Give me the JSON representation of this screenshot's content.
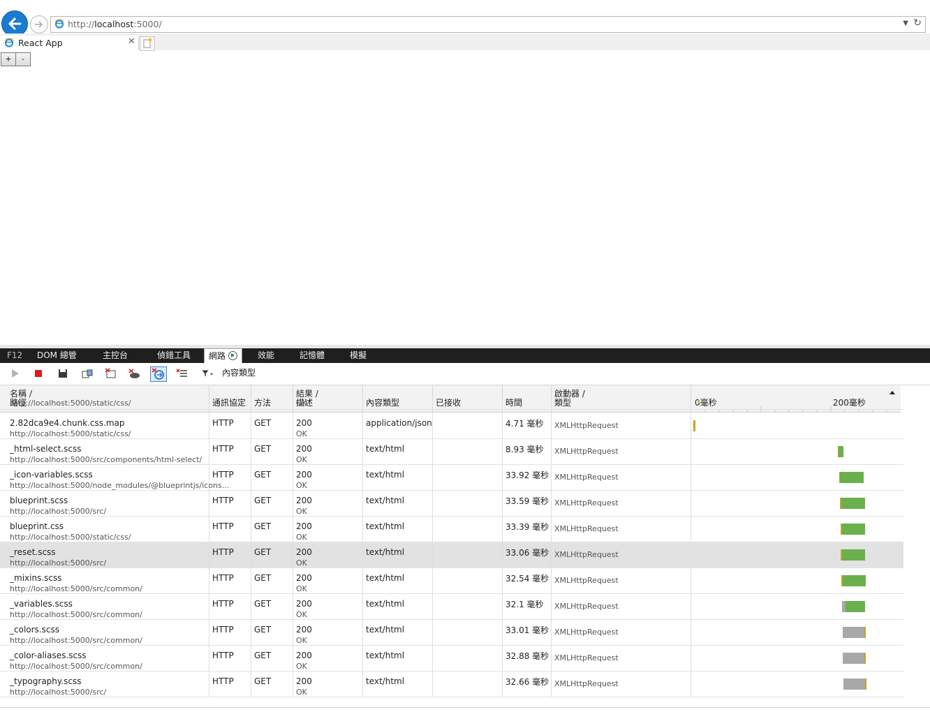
{
  "browser": {
    "url_prefix": "http://",
    "url_host": "localhost",
    "url_suffix": ":5000/",
    "tab_title": "React App"
  },
  "page": {
    "zoom_in_label": "+",
    "zoom_out_label": "-"
  },
  "devtools": {
    "tabs": [
      "F12",
      "DOM 總管",
      "主控台",
      "偵錯工具",
      "網路",
      "效能",
      "記憶體",
      "模擬"
    ],
    "active_tab": "網路",
    "filter_label": "內容類型",
    "columns": {
      "name": [
        "名稱 /",
        "路徑"
      ],
      "protocol": "通訊協定",
      "method": "方法",
      "result": [
        "結果 /",
        "描述"
      ],
      "content_type": "內容類型",
      "received": "已接收",
      "time": "時間",
      "initiator": [
        "啟動器 /",
        "類型"
      ],
      "timeline_start": "0毫秒",
      "timeline_mid": "200毫秒"
    },
    "partial_row": {
      "path": "http://localhost:5000/static/css/",
      "desc": "OK"
    },
    "rows": [
      {
        "name": "2.82dca9e4.chunk.css.map",
        "path": "http://localhost:5000/static/css/",
        "protocol": "HTTP",
        "method": "GET",
        "code": "200",
        "desc": "OK",
        "type": "application/json",
        "time": "4.71 毫秒",
        "initiator": "XMLHttpRequest",
        "selected": false,
        "bar_start_ms": 3,
        "wait_ms": 0.5,
        "recv_ms": 2,
        "recv_color": "#c9a227"
      },
      {
        "name": "_html-select.scss",
        "path": "http://localhost:5000/src/components/html-select/",
        "protocol": "HTTP",
        "method": "GET",
        "code": "200",
        "desc": "OK",
        "type": "text/html",
        "time": "8.93 毫秒",
        "initiator": "XMLHttpRequest",
        "selected": false,
        "bar_start_ms": 210,
        "wait_ms": 0.5,
        "recv_ms": 7,
        "recv_color": "#6ab04c"
      },
      {
        "name": "_icon-variables.scss",
        "path": "http://localhost:5000/node_modules/@blueprintjs/icons...",
        "protocol": "HTTP",
        "method": "GET",
        "code": "200",
        "desc": "OK",
        "type": "text/html",
        "time": "33.92 毫秒",
        "initiator": "XMLHttpRequest",
        "selected": false,
        "bar_start_ms": 212,
        "wait_ms": 1,
        "recv_ms": 34,
        "recv_color": "#6ab04c"
      },
      {
        "name": "blueprint.scss",
        "path": "http://localhost:5000/src/",
        "protocol": "HTTP",
        "method": "GET",
        "code": "200",
        "desc": "OK",
        "type": "text/html",
        "time": "33.59 毫秒",
        "initiator": "XMLHttpRequest",
        "selected": false,
        "bar_start_ms": 213,
        "wait_ms": 2,
        "recv_ms": 34,
        "recv_color": "#6ab04c"
      },
      {
        "name": "blueprint.css",
        "path": "http://localhost:5000/static/css/",
        "protocol": "HTTP",
        "method": "GET",
        "code": "200",
        "desc": "OK",
        "type": "text/html",
        "time": "33.39 毫秒",
        "initiator": "XMLHttpRequest",
        "selected": false,
        "bar_start_ms": 214,
        "wait_ms": 2,
        "recv_ms": 33,
        "recv_color": "#6ab04c"
      },
      {
        "name": "_reset.scss",
        "path": "http://localhost:5000/src/",
        "protocol": "HTTP",
        "method": "GET",
        "code": "200",
        "desc": "OK",
        "type": "text/html",
        "time": "33.06 毫秒",
        "initiator": "XMLHttpRequest",
        "selected": true,
        "bar_start_ms": 214,
        "wait_ms": 2,
        "recv_ms": 33,
        "recv_color": "#6ab04c"
      },
      {
        "name": "_mixins.scss",
        "path": "http://localhost:5000/src/common/",
        "protocol": "HTTP",
        "method": "GET",
        "code": "200",
        "desc": "OK",
        "type": "text/html",
        "time": "32.54 毫秒",
        "initiator": "XMLHttpRequest",
        "selected": false,
        "bar_start_ms": 215,
        "wait_ms": 2,
        "recv_ms": 33,
        "recv_color": "#6ab04c"
      },
      {
        "name": "_variables.scss",
        "path": "http://localhost:5000/src/common/",
        "protocol": "HTTP",
        "method": "GET",
        "code": "200",
        "desc": "OK",
        "type": "text/html",
        "time": "32.1 毫秒",
        "initiator": "XMLHttpRequest",
        "selected": false,
        "bar_start_ms": 216,
        "wait_ms": 5,
        "recv_ms": 28,
        "recv_color": "#6ab04c"
      },
      {
        "name": "_colors.scss",
        "path": "http://localhost:5000/src/common/",
        "protocol": "HTTP",
        "method": "GET",
        "code": "200",
        "desc": "OK",
        "type": "text/html",
        "time": "33.01 毫秒",
        "initiator": "XMLHttpRequest",
        "selected": false,
        "bar_start_ms": 217,
        "wait_ms": 31,
        "recv_ms": 2,
        "recv_color": "#c9a227"
      },
      {
        "name": "_color-aliases.scss",
        "path": "http://localhost:5000/src/common/",
        "protocol": "HTTP",
        "method": "GET",
        "code": "200",
        "desc": "OK",
        "type": "text/html",
        "time": "32.88 毫秒",
        "initiator": "XMLHttpRequest",
        "selected": false,
        "bar_start_ms": 217,
        "wait_ms": 31,
        "recv_ms": 2,
        "recv_color": "#c9a227"
      },
      {
        "name": "_typography.scss",
        "path": "http://localhost:5000/src/",
        "protocol": "HTTP",
        "method": "GET",
        "code": "200",
        "desc": "OK",
        "type": "text/html",
        "time": "32.66 毫秒",
        "initiator": "XMLHttpRequest",
        "selected": false,
        "bar_start_ms": 218,
        "wait_ms": 31,
        "recv_ms": 2,
        "recv_color": "#c9a227"
      }
    ],
    "colors": {
      "wait": "#a8a8a8",
      "stall": "#c9a227",
      "receive": "#6ab04c"
    }
  }
}
